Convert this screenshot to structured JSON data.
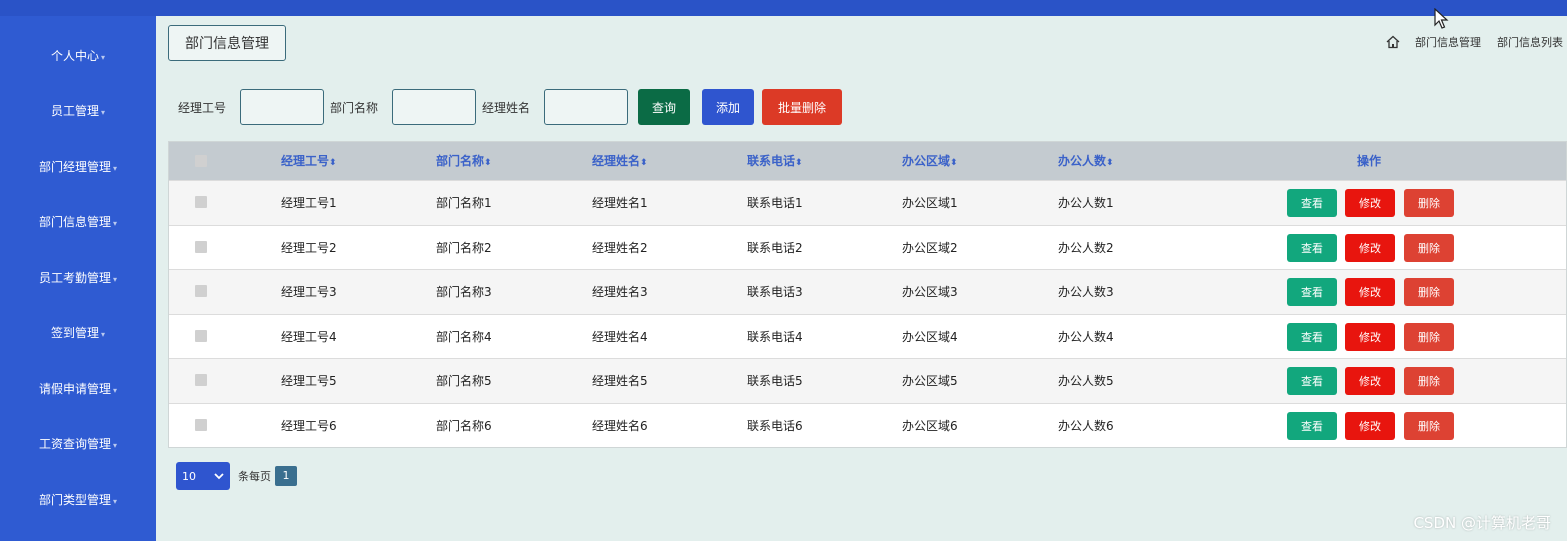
{
  "sidebar": {
    "items": [
      {
        "label": "个人中心"
      },
      {
        "label": "员工管理"
      },
      {
        "label": "部门经理管理"
      },
      {
        "label": "部门信息管理"
      },
      {
        "label": "员工考勤管理"
      },
      {
        "label": "签到管理"
      },
      {
        "label": "请假申请管理"
      },
      {
        "label": "工资查询管理"
      },
      {
        "label": "部门类型管理"
      }
    ],
    "caret": "▾"
  },
  "header": {
    "page_button": "部门信息管理",
    "breadcrumb": [
      "部门信息管理",
      "部门信息列表"
    ]
  },
  "search": {
    "labels": [
      "经理工号",
      "部门名称",
      "经理姓名"
    ],
    "query_label": "查询",
    "add_label": "添加",
    "batch_delete_label": "批量删除"
  },
  "table": {
    "columns": [
      "经理工号",
      "部门名称",
      "经理姓名",
      "联系电话",
      "办公区域",
      "办公人数"
    ],
    "sort_icon": "⬍",
    "ops_header": "操作",
    "rows": [
      [
        "经理工号1",
        "部门名称1",
        "经理姓名1",
        "联系电话1",
        "办公区域1",
        "办公人数1"
      ],
      [
        "经理工号2",
        "部门名称2",
        "经理姓名2",
        "联系电话2",
        "办公区域2",
        "办公人数2"
      ],
      [
        "经理工号3",
        "部门名称3",
        "经理姓名3",
        "联系电话3",
        "办公区域3",
        "办公人数3"
      ],
      [
        "经理工号4",
        "部门名称4",
        "经理姓名4",
        "联系电话4",
        "办公区域4",
        "办公人数4"
      ],
      [
        "经理工号5",
        "部门名称5",
        "经理姓名5",
        "联系电话5",
        "办公区域5",
        "办公人数5"
      ],
      [
        "经理工号6",
        "部门名称6",
        "经理姓名6",
        "联系电话6",
        "办公区域6",
        "办公人数6"
      ]
    ],
    "view_label": "查看",
    "edit_label": "修改",
    "delete_label": "删除"
  },
  "pager": {
    "page_size": "10",
    "page_size_text": "条每页",
    "current_page": "1"
  },
  "watermark": "CSDN @计算机老哥",
  "colors": {
    "sidebar": "#2f5bd2",
    "query": "#0b6b45",
    "add": "#2f55cf",
    "batch_delete": "#dc3a26",
    "view": "#12a77d",
    "edit": "#e8150e",
    "delete": "#dd4233",
    "header_text": "#3b62c9"
  }
}
